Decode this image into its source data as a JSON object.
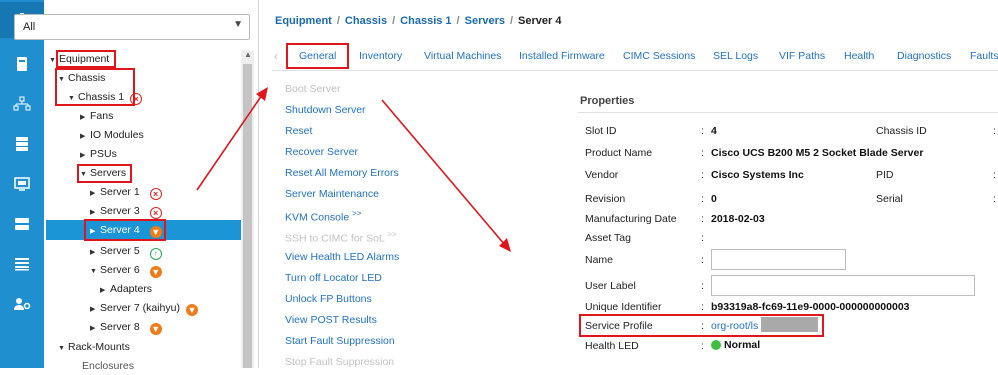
{
  "sidebar_icons": [
    "equipment-icon",
    "servers-icon",
    "network-icon",
    "storage-icon",
    "vm-icon",
    "chassis-icon",
    "list-icon",
    "admin-icon"
  ],
  "filter": {
    "value": "All"
  },
  "tree": {
    "equipment": "Equipment",
    "chassis": "Chassis",
    "chassis1": "Chassis 1",
    "fans": "Fans",
    "io_modules": "IO Modules",
    "psus": "PSUs",
    "servers": "Servers",
    "server1": "Server 1",
    "server3": "Server 3",
    "server4": "Server 4",
    "server5": "Server 5",
    "server6": "Server 6",
    "adapters": "Adapters",
    "server7": "Server 7 (kaihyu)",
    "server8": "Server 8",
    "rack_mounts": "Rack-Mounts",
    "enclosures": "Enclosures"
  },
  "breadcrumb": [
    "Equipment",
    "Chassis",
    "Chassis 1",
    "Servers",
    "Server 4"
  ],
  "tabs": [
    "General",
    "Inventory",
    "Virtual Machines",
    "Installed Firmware",
    "CIMC Sessions",
    "SEL Logs",
    "VIF Paths",
    "Health",
    "Diagnostics",
    "Faults"
  ],
  "actions": {
    "boot_server": "Boot Server",
    "shutdown_server": "Shutdown Server",
    "reset": "Reset",
    "recover_server": "Recover Server",
    "reset_memory_errors": "Reset All Memory Errors",
    "server_maintenance": "Server Maintenance",
    "kvm_console": "KVM Console",
    "kvm_suffix": ">>",
    "ssh_cimc": "SSH to CIMC for SoL",
    "ssh_suffix": ">>",
    "view_health_led": "View Health LED Alarms",
    "turn_off_locator": "Turn off Locator LED",
    "unlock_fp": "Unlock FP Buttons",
    "view_post": "View POST Results",
    "start_fault": "Start Fault Suppression",
    "stop_fault": "Stop Fault Suppression"
  },
  "properties": {
    "title": "Properties",
    "slot_id_label": "Slot ID",
    "slot_id": "4",
    "chassis_id_label": "Chassis ID",
    "product_name_label": "Product Name",
    "product_name": "Cisco UCS B200 M5 2 Socket Blade Server",
    "vendor_label": "Vendor",
    "vendor": "Cisco Systems Inc",
    "pid_label": "PID",
    "revision_label": "Revision",
    "revision": "0",
    "serial_label": "Serial",
    "mfg_date_label": "Manufacturing Date",
    "mfg_date": "2018-02-03",
    "asset_tag_label": "Asset Tag",
    "name_label": "Name",
    "user_label_label": "User Label",
    "uid_label": "Unique Identifier",
    "uid": "b93319a8-fc69-11e9-0000-000000000003",
    "service_profile_label": "Service Profile",
    "service_profile": "org-root/ls",
    "health_led_label": "Health LED",
    "health_led": "Normal",
    "colon": ":"
  },
  "colors": {
    "rail": "#1f8fd0",
    "selected": "#1b95d5",
    "link": "#1f73c4",
    "highlight": "#e0161d",
    "critical": "#e0261d",
    "major": "#f07b19",
    "ok": "#26a65b"
  }
}
